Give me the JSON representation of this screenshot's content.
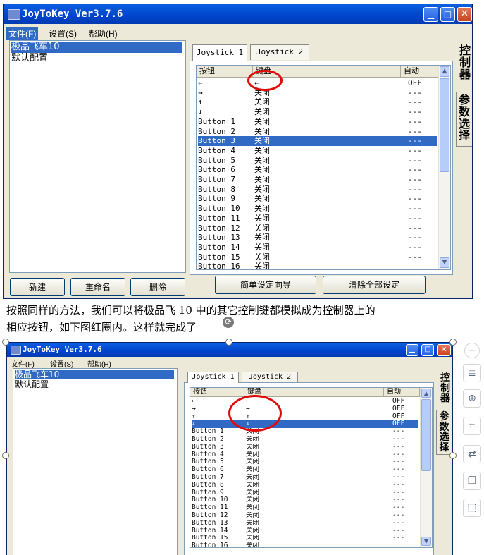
{
  "windows": [
    {
      "title": "JoyToKey Ver3.7.6",
      "menu": [
        {
          "label": "文件(F)",
          "active": true
        },
        {
          "label": "设置(S)",
          "active": false
        },
        {
          "label": "帮助(H)",
          "active": false
        }
      ],
      "profiles": [
        "极品飞车10",
        "默认配置"
      ],
      "selected_profile": 0,
      "buttons": {
        "new": "新建",
        "rename": "重命名",
        "delete": "删除",
        "wizard": "简单设定向导",
        "clear_all": "清除全部设定"
      },
      "tabs": [
        "Joystick 1",
        "Joystick 2"
      ],
      "side_tabs": [
        "控制器",
        "参数选择"
      ],
      "columns": [
        "按钮",
        "键盘",
        "自动"
      ],
      "rows": [
        [
          "←",
          "←",
          "OFF"
        ],
        [
          "→",
          "关闭",
          "---"
        ],
        [
          "↑",
          "关闭",
          "---"
        ],
        [
          "↓",
          "关闭",
          "---"
        ],
        [
          "Button 1",
          "关闭",
          "---"
        ],
        [
          "Button 2",
          "关闭",
          "---"
        ],
        [
          "Button 3",
          "关闭",
          "---"
        ],
        [
          "Button 4",
          "关闭",
          "---"
        ],
        [
          "Button 5",
          "关闭",
          "---"
        ],
        [
          "Button 6",
          "关闭",
          "---"
        ],
        [
          "Button 7",
          "关闭",
          "---"
        ],
        [
          "Button 8",
          "关闭",
          "---"
        ],
        [
          "Button 9",
          "关闭",
          "---"
        ],
        [
          "Button 10",
          "关闭",
          "---"
        ],
        [
          "Button 11",
          "关闭",
          "---"
        ],
        [
          "Button 12",
          "关闭",
          "---"
        ],
        [
          "Button 13",
          "关闭",
          "---"
        ],
        [
          "Button 14",
          "关闭",
          "---"
        ],
        [
          "Button 15",
          "关闭",
          "---"
        ],
        [
          "Button 16",
          "关闭",
          ""
        ]
      ],
      "selected_row": 6
    },
    {
      "title": "JoyToKey Ver3.7.6",
      "menu": [
        {
          "label": "文件(F)",
          "active": false
        },
        {
          "label": "设置(S)",
          "active": false
        },
        {
          "label": "帮助(H)",
          "active": false
        }
      ],
      "profiles": [
        "极品飞车10",
        "默认配置"
      ],
      "selected_profile": 0,
      "buttons": {},
      "tabs": [
        "Joystick 1",
        "Joystick 2"
      ],
      "side_tabs": [
        "控制器",
        "参数选择"
      ],
      "columns": [
        "按钮",
        "键盘",
        "自动"
      ],
      "rows": [
        [
          "←",
          "←",
          "OFF"
        ],
        [
          "→",
          "→",
          "OFF"
        ],
        [
          "↑",
          "↑",
          "OFF"
        ],
        [
          "↓",
          "↓",
          "OFF"
        ],
        [
          "Button 1",
          "关闭",
          "---"
        ],
        [
          "Button 2",
          "关闭",
          "---"
        ],
        [
          "Button 3",
          "关闭",
          "---"
        ],
        [
          "Button 4",
          "关闭",
          "---"
        ],
        [
          "Button 5",
          "关闭",
          "---"
        ],
        [
          "Button 6",
          "关闭",
          "---"
        ],
        [
          "Button 7",
          "关闭",
          "---"
        ],
        [
          "Button 8",
          "关闭",
          "---"
        ],
        [
          "Button 9",
          "关闭",
          "---"
        ],
        [
          "Button 10",
          "关闭",
          "---"
        ],
        [
          "Button 11",
          "关闭",
          "---"
        ],
        [
          "Button 12",
          "关闭",
          "---"
        ],
        [
          "Button 13",
          "关闭",
          "---"
        ],
        [
          "Button 14",
          "关闭",
          "---"
        ],
        [
          "Button 15",
          "关闭",
          "---"
        ],
        [
          "Button 16",
          "关闭",
          ""
        ]
      ],
      "selected_row": 3
    }
  ],
  "paragraph": [
    "按照同样的方法，我们可以将极品飞 10 中的其它控制键都模拟成为控制器上的",
    "相应按钮，如下图红圈内。这样就完成了"
  ],
  "toolbar": [
    "minus-circle-icon",
    "text-recognize-icon",
    "zoom-in-icon",
    "crop-icon",
    "translate-icon",
    "copy-icon",
    "screenshot-select-icon"
  ],
  "colors": {
    "accent": "#316ac5",
    "title": "#0054e3",
    "annotation": "#e00a0a"
  }
}
